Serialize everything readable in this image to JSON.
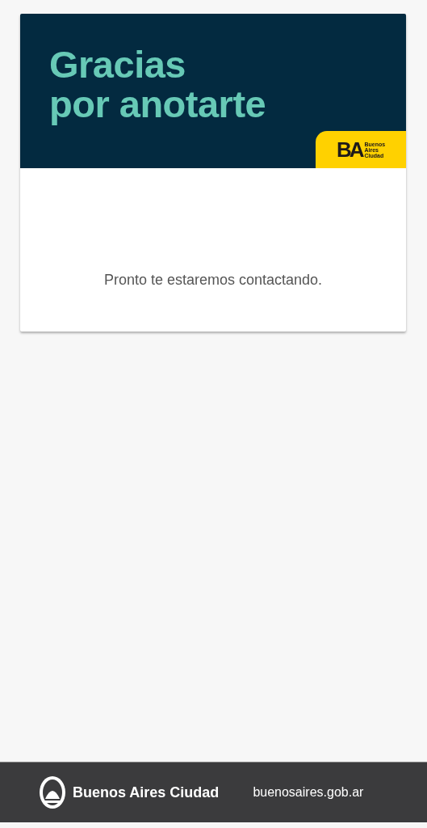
{
  "card": {
    "title_lines": [
      "Gracias",
      "por anotarte"
    ],
    "badge": {
      "monogram": "BA",
      "lines": [
        "Buenos",
        "Aires",
        "Ciudad"
      ]
    },
    "message": "Pronto te estaremos contactando."
  },
  "footer": {
    "brand": "Buenos Aires Ciudad",
    "link": "buenosaires.gob.ar"
  }
}
